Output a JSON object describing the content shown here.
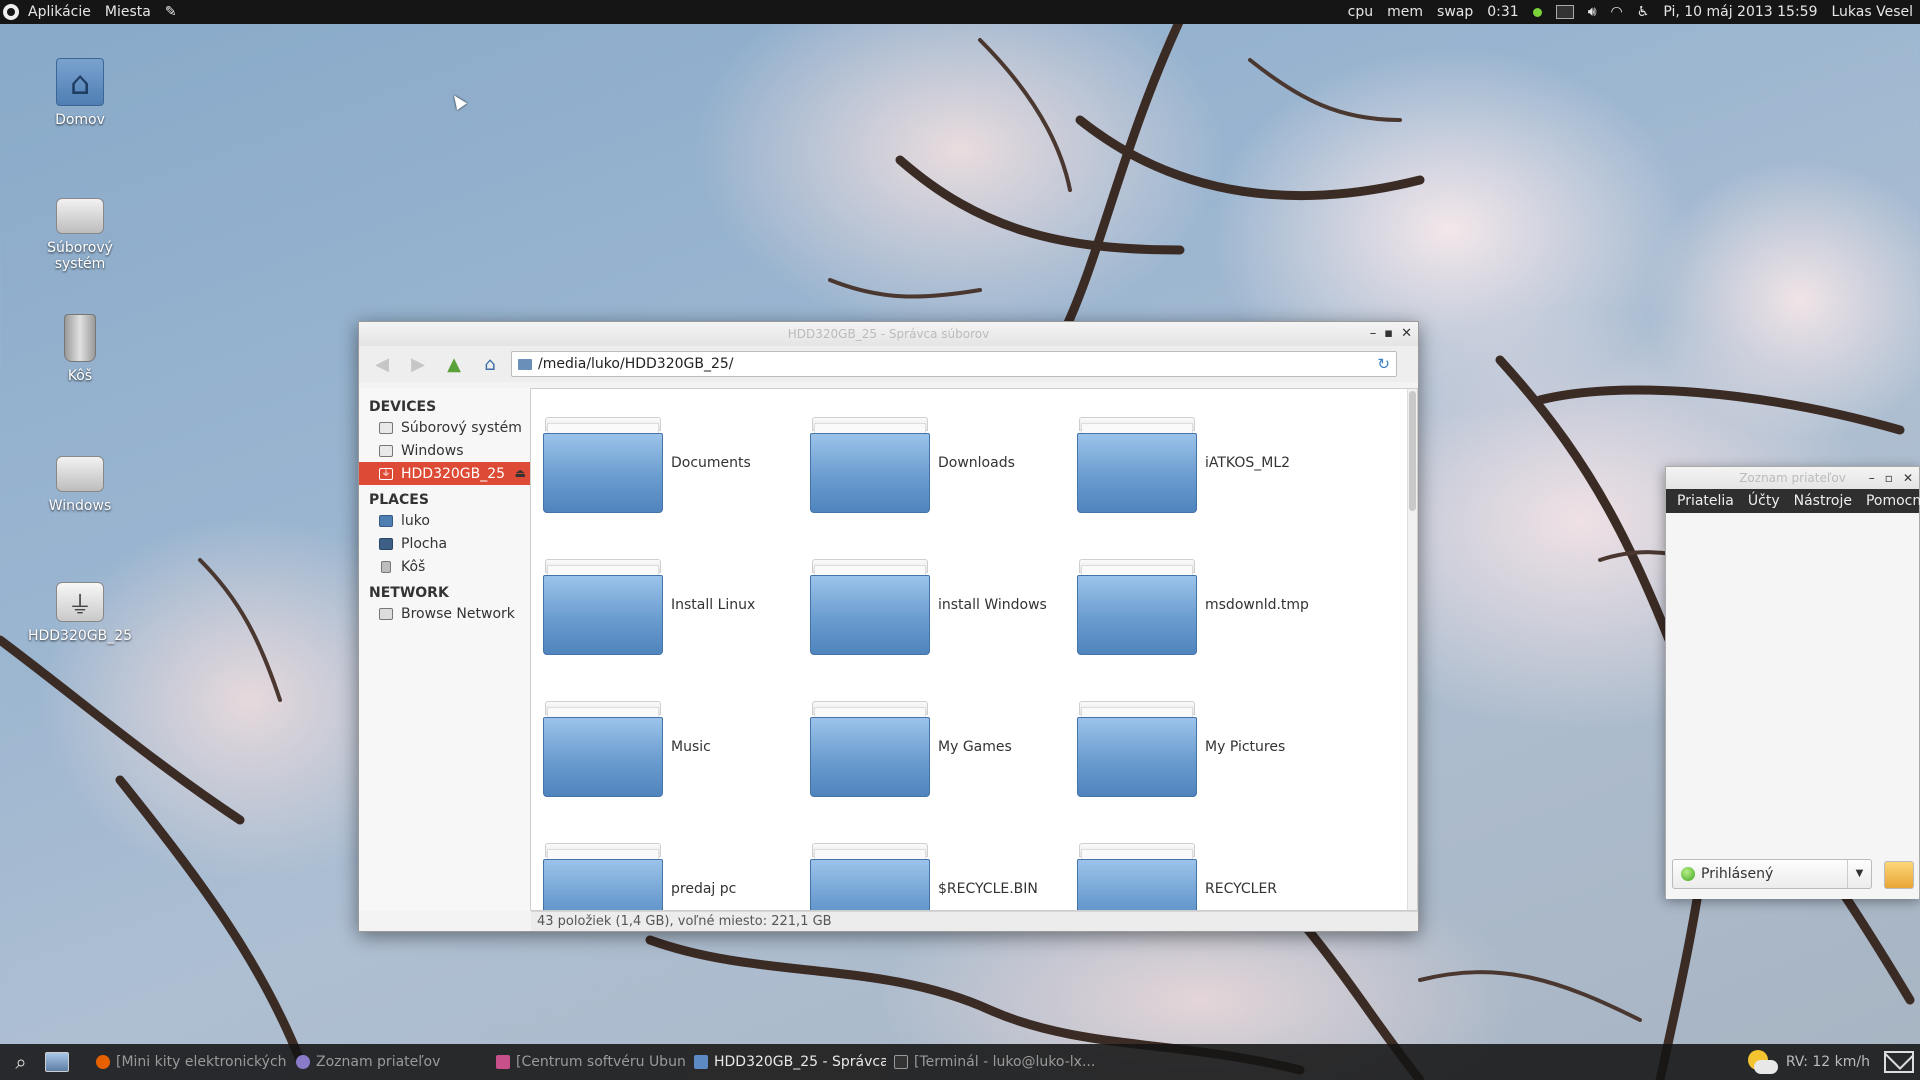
{
  "top_panel": {
    "menu_applications": "Aplikácie",
    "menu_places": "Miesta",
    "cpu": "cpu",
    "mem": "mem",
    "swap": "swap",
    "time_short": "0:31",
    "datetime": "Pi, 10 máj 2013 15:59",
    "user": "Lukas Vesel"
  },
  "desktop_icons": [
    {
      "label": "Domov",
      "icon": "home-folder-icon"
    },
    {
      "label": "Súborový systém",
      "icon": "harddisk-icon"
    },
    {
      "label": "Kôš",
      "icon": "trash-icon"
    },
    {
      "label": "Windows",
      "icon": "harddisk-icon"
    },
    {
      "label": "HDD320GB_25",
      "icon": "usb-drive-icon"
    }
  ],
  "file_manager": {
    "title": "HDD320GB_25 - Správca súborov",
    "path": "/media/luko/HDD320GB_25/",
    "sidebar": {
      "devices_header": "DEVICES",
      "devices": [
        "Súborový systém",
        "Windows",
        "HDD320GB_25"
      ],
      "places_header": "PLACES",
      "places": [
        "luko",
        "Plocha",
        "Kôš"
      ],
      "network_header": "NETWORK",
      "network": [
        "Browse Network"
      ]
    },
    "folders": [
      "Documents",
      "Downloads",
      "iATKOS_ML2",
      "Install Linux",
      "install Windows",
      "msdownld.tmp",
      "Music",
      "My Games",
      "My Pictures",
      "predaj pc",
      "$RECYCLE.BIN",
      "RECYCLER"
    ],
    "status": "43 položiek (1,4 GB), voľné miesto: 221,1 GB"
  },
  "buddy_list": {
    "title": "Zoznam priateľov",
    "menu": [
      "Priatelia",
      "Účty",
      "Nástroje",
      "Pomocník"
    ],
    "status": "Prihlásený"
  },
  "bottom_panel": {
    "tasks": [
      "[Mini kity elektronických ...",
      "Zoznam priateľov",
      "[Centrum softvéru Ubun...",
      "HDD320GB_25 - Správca ...",
      "[Terminál - luko@luko-lx..."
    ],
    "weather": "RV: 12 km/h"
  }
}
